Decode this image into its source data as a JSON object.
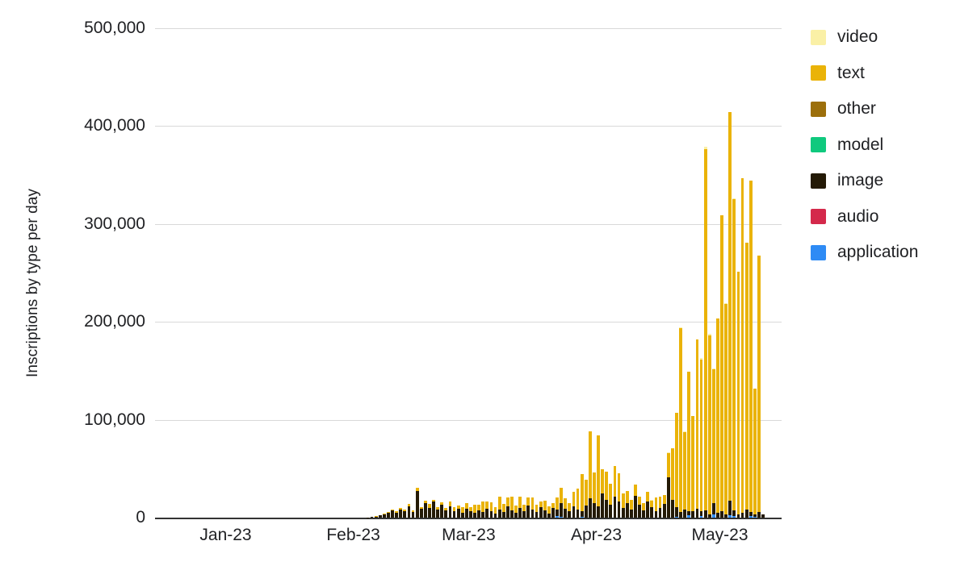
{
  "chart_data": {
    "type": "bar",
    "stacked": true,
    "title": "",
    "subtitle": "",
    "xlabel": "",
    "ylabel": "Inscriptions by type per day",
    "ylim": [
      0,
      500000
    ],
    "ytick_labels": [
      "0",
      "100,000",
      "200,000",
      "300,000",
      "400,000",
      "500,000"
    ],
    "ytick_values": [
      0,
      100000,
      200000,
      300000,
      400000,
      500000
    ],
    "xtick_labels": [
      "Jan-23",
      "Feb-23",
      "Mar-23",
      "Apr-23",
      "May-23"
    ],
    "xtick_positions_day": [
      15,
      46,
      74,
      105,
      135
    ],
    "grid": "horizontal",
    "legend_position": "right",
    "x_start": "2023-01-01",
    "x_unit": "day",
    "n_points": 150,
    "series": [
      {
        "name": "video",
        "color": "#faf0a6",
        "values": [
          0,
          0,
          0,
          0,
          0,
          0,
          0,
          0,
          0,
          0,
          0,
          0,
          0,
          0,
          0,
          0,
          0,
          0,
          0,
          0,
          0,
          0,
          0,
          0,
          0,
          0,
          0,
          0,
          0,
          0,
          0,
          0,
          0,
          0,
          0,
          0,
          0,
          0,
          0,
          0,
          0,
          0,
          0,
          0,
          0,
          0,
          0,
          0,
          0,
          0,
          0,
          0,
          0,
          0,
          0,
          0,
          0,
          0,
          0,
          0,
          0,
          0,
          0,
          0,
          0,
          0,
          0,
          0,
          0,
          0,
          0,
          0,
          0,
          0,
          0,
          0,
          0,
          0,
          0,
          0,
          0,
          0,
          0,
          0,
          0,
          0,
          0,
          0,
          0,
          0,
          0,
          0,
          0,
          0,
          0,
          0,
          0,
          0,
          0,
          0,
          0,
          0,
          0,
          0,
          0,
          0,
          0,
          0,
          0,
          0,
          0,
          0,
          0,
          0,
          0,
          0,
          0,
          0,
          400,
          0,
          0,
          0,
          900,
          0,
          0,
          600,
          1200,
          0,
          0,
          0,
          1800,
          2400,
          1500,
          900,
          0,
          0,
          1200,
          0,
          600,
          0,
          0,
          0,
          0,
          0,
          0,
          0,
          0,
          0
        ]
      },
      {
        "name": "text",
        "color": "#eab308",
        "values": [
          0,
          0,
          0,
          0,
          0,
          0,
          0,
          0,
          0,
          0,
          0,
          0,
          0,
          0,
          0,
          0,
          0,
          0,
          0,
          0,
          0,
          0,
          0,
          0,
          0,
          0,
          0,
          0,
          0,
          0,
          0,
          0,
          0,
          0,
          0,
          0,
          0,
          0,
          0,
          0,
          0,
          0,
          0,
          0,
          0,
          0,
          0,
          0,
          0,
          0,
          0,
          200,
          400,
          600,
          900,
          1400,
          1900,
          1100,
          2200,
          2600,
          2100,
          3400,
          1600,
          2600,
          3800,
          2100,
          1800,
          2900,
          2400,
          5400,
          4100,
          3000,
          5200,
          6100,
          4800,
          8200,
          5600,
          11400,
          7400,
          9600,
          6800,
          12600,
          8200,
          9200,
          14200,
          7600,
          11800,
          6400,
          8800,
          12400,
          7400,
          6200,
          9800,
          7200,
          5400,
          12800,
          15200,
          10400,
          8600,
          14800,
          21200,
          38600,
          26400,
          68400,
          31600,
          72600,
          24400,
          28600,
          21400,
          31200,
          29400,
          14600,
          12200,
          9800,
          11600,
          8400,
          7200,
          9400,
          6800,
          14200,
          11400,
          8600,
          24200,
          52800,
          96400,
          188600,
          78400,
          142600,
          96800,
          172400,
          154200,
          368400,
          182600,
          136800,
          198400,
          302400,
          214600,
          396800,
          318600,
          248400,
          342600,
          272400,
          338400,
          128400,
          262400
        ]
      },
      {
        "name": "other",
        "color": "#9c6f0b",
        "values": [
          0,
          0,
          0,
          0,
          0,
          0,
          0,
          0,
          0,
          0,
          0,
          0,
          0,
          0,
          0,
          0,
          0,
          0,
          0,
          0,
          0,
          0,
          0,
          0,
          0,
          0,
          0,
          0,
          0,
          0,
          0,
          0,
          0,
          0,
          0,
          0,
          0,
          0,
          0,
          0,
          0,
          0,
          0,
          0,
          0,
          0,
          0,
          0,
          0,
          0,
          0,
          0,
          0,
          0,
          0,
          0,
          0,
          0,
          0,
          0,
          0,
          0,
          0,
          0,
          0,
          0,
          0,
          0,
          0,
          0,
          0,
          0,
          0,
          0,
          0,
          0,
          0,
          0,
          0,
          0,
          0,
          0,
          0,
          0,
          0,
          0,
          0,
          0,
          0,
          0,
          0,
          0,
          0,
          0,
          0,
          0,
          0,
          0,
          0,
          0,
          0,
          0,
          0,
          0,
          0,
          0,
          0,
          0,
          0,
          0,
          0,
          0,
          0,
          0,
          0,
          0,
          0,
          0,
          0,
          0,
          0,
          0,
          0,
          0,
          0,
          0,
          0,
          0,
          0,
          0,
          0,
          0,
          0,
          0,
          0,
          0,
          0,
          0,
          0,
          0,
          0,
          0,
          0,
          0,
          0,
          0,
          0,
          0
        ]
      },
      {
        "name": "model",
        "color": "#0fc97e",
        "values": [
          0,
          0,
          0,
          0,
          0,
          0,
          0,
          0,
          0,
          0,
          0,
          0,
          0,
          0,
          0,
          0,
          0,
          0,
          0,
          0,
          0,
          0,
          0,
          0,
          0,
          0,
          0,
          0,
          0,
          0,
          0,
          0,
          0,
          0,
          0,
          0,
          0,
          0,
          0,
          0,
          0,
          0,
          0,
          0,
          0,
          0,
          0,
          0,
          0,
          0,
          0,
          0,
          0,
          0,
          0,
          0,
          0,
          0,
          0,
          0,
          0,
          0,
          0,
          0,
          0,
          0,
          0,
          0,
          0,
          0,
          0,
          0,
          0,
          0,
          0,
          0,
          0,
          0,
          0,
          0,
          0,
          0,
          0,
          0,
          0,
          0,
          0,
          0,
          0,
          0,
          0,
          0,
          0,
          0,
          0,
          0,
          0,
          0,
          0,
          0,
          0,
          0,
          0,
          0,
          0,
          0,
          0,
          0,
          0,
          0,
          0,
          0,
          0,
          0,
          0,
          0,
          0,
          0,
          0,
          0,
          0,
          0,
          0,
          0,
          0,
          0,
          0,
          0,
          0,
          0,
          0,
          0,
          0,
          0,
          0,
          0,
          0,
          0,
          0,
          0,
          0,
          0,
          0,
          0,
          0,
          0,
          0,
          0
        ]
      },
      {
        "name": "image",
        "color": "#241a06",
        "values": [
          0,
          0,
          0,
          0,
          0,
          0,
          0,
          0,
          0,
          0,
          0,
          0,
          0,
          0,
          0,
          0,
          0,
          0,
          0,
          0,
          0,
          0,
          0,
          0,
          0,
          0,
          0,
          0,
          0,
          0,
          0,
          0,
          0,
          0,
          0,
          0,
          0,
          0,
          0,
          0,
          0,
          0,
          0,
          0,
          0,
          0,
          0,
          0,
          0,
          300,
          800,
          1600,
          2400,
          3600,
          5200,
          7200,
          4600,
          8400,
          6200,
          11400,
          5400,
          26800,
          9200,
          14600,
          10200,
          16400,
          8600,
          12800,
          7400,
          11200,
          6800,
          9400,
          5200,
          8800,
          6200,
          4800,
          7600,
          5400,
          9200,
          6400,
          4200,
          8600,
          5800,
          11400,
          7200,
          4600,
          9800,
          6400,
          12200,
          8400,
          5600,
          10400,
          7800,
          4200,
          9600,
          6800,
          14200,
          9400,
          6200,
          11800,
          8600,
          5400,
          12400,
          19600,
          14800,
          11200,
          24800,
          18400,
          13600,
          21400,
          16200,
          9800,
          14600,
          8400,
          22400,
          12800,
          7600,
          16800,
          11200,
          6400,
          9800,
          14200,
          41600,
          18400,
          9200,
          5400,
          8600,
          4200,
          6800,
          9400,
          5200,
          7800,
          3600,
          11400,
          4800,
          6200,
          3400,
          14600,
          5800,
          3200,
          4600,
          8200,
          3800,
          2400,
          5600,
          3200
        ]
      },
      {
        "name": "audio",
        "color": "#d4294b",
        "values": [
          0,
          0,
          0,
          0,
          0,
          0,
          0,
          0,
          0,
          0,
          0,
          0,
          0,
          0,
          0,
          0,
          0,
          0,
          0,
          0,
          0,
          0,
          0,
          0,
          0,
          0,
          0,
          0,
          0,
          0,
          0,
          0,
          0,
          0,
          0,
          0,
          0,
          0,
          0,
          0,
          0,
          0,
          0,
          0,
          0,
          0,
          0,
          0,
          0,
          0,
          0,
          0,
          0,
          0,
          0,
          0,
          0,
          0,
          0,
          0,
          0,
          0,
          0,
          0,
          0,
          0,
          0,
          0,
          0,
          0,
          0,
          0,
          0,
          0,
          0,
          0,
          0,
          0,
          0,
          0,
          0,
          0,
          0,
          0,
          0,
          0,
          0,
          0,
          0,
          0,
          0,
          0,
          0,
          0,
          0,
          0,
          0,
          0,
          0,
          0,
          0,
          0,
          0,
          0,
          0,
          0,
          0,
          0,
          0,
          0,
          0,
          0,
          0,
          0,
          0,
          0,
          0,
          0,
          0,
          0,
          0,
          0,
          0,
          0,
          0,
          0,
          0,
          0,
          0,
          0,
          0,
          0,
          0,
          0,
          0,
          0,
          0,
          0,
          0,
          0,
          0,
          0,
          0,
          0,
          0,
          0,
          0,
          0
        ]
      },
      {
        "name": "application",
        "color": "#2e8bf5",
        "values": [
          0,
          0,
          0,
          0,
          0,
          0,
          0,
          0,
          0,
          0,
          0,
          0,
          0,
          0,
          0,
          0,
          0,
          0,
          0,
          0,
          0,
          0,
          0,
          0,
          0,
          0,
          0,
          0,
          0,
          0,
          0,
          0,
          0,
          0,
          0,
          0,
          0,
          0,
          0,
          0,
          0,
          0,
          0,
          0,
          0,
          0,
          0,
          0,
          0,
          0,
          0,
          0,
          0,
          0,
          0,
          0,
          0,
          0,
          0,
          0,
          0,
          0,
          0,
          0,
          0,
          0,
          0,
          0,
          0,
          0,
          0,
          0,
          0,
          0,
          0,
          0,
          0,
          0,
          0,
          0,
          0,
          0,
          0,
          0,
          0,
          0,
          0,
          0,
          0,
          0,
          0,
          0,
          0,
          0,
          0,
          1400,
          800,
          0,
          0,
          0,
          0,
          600,
          0,
          0,
          0,
          0,
          0,
          0,
          0,
          0,
          0,
          0,
          0,
          0,
          0,
          0,
          0,
          0,
          0,
          0,
          0,
          0,
          0,
          0,
          1200,
          0,
          0,
          2400,
          0,
          0,
          1800,
          0,
          0,
          3200,
          0,
          0,
          0,
          2600,
          1400,
          0,
          0,
          0,
          1800,
          900,
          0,
          0
        ]
      }
    ]
  },
  "legend": {
    "items": [
      {
        "label": "video",
        "color": "#faf0a6"
      },
      {
        "label": "text",
        "color": "#eab308"
      },
      {
        "label": "other",
        "color": "#9c6f0b"
      },
      {
        "label": "model",
        "color": "#0fc97e"
      },
      {
        "label": "image",
        "color": "#241a06"
      },
      {
        "label": "audio",
        "color": "#d4294b"
      },
      {
        "label": "application",
        "color": "#2e8bf5"
      }
    ]
  }
}
